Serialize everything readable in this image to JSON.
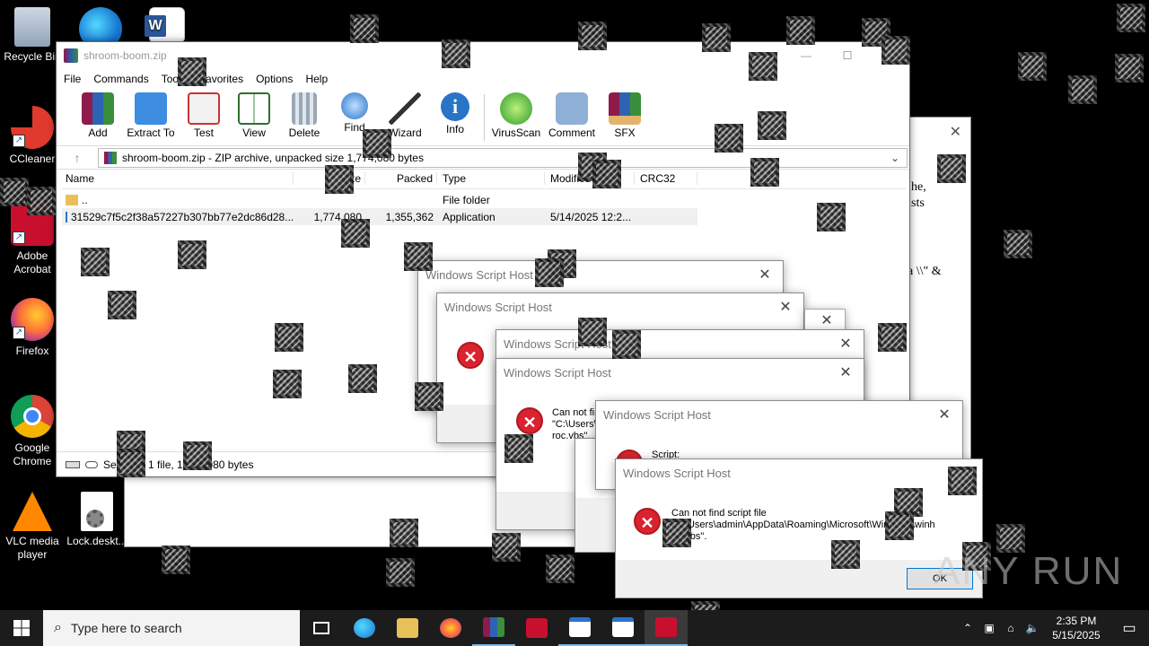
{
  "desktop": {
    "icons": [
      {
        "label": "Recycle Bin",
        "icon": "recycle-bin-icon"
      },
      {
        "label": "CCleaner",
        "icon": "ccleaner-icon"
      },
      {
        "label": "Adobe Acrobat",
        "icon": "adobe-acrobat-icon"
      },
      {
        "label": "Firefox",
        "icon": "firefox-icon"
      },
      {
        "label": "Google Chrome",
        "icon": "chrome-icon"
      },
      {
        "label": "VLC media player",
        "icon": "vlc-icon"
      },
      {
        "label": "Lock.deskt...",
        "icon": "settings-file-icon"
      }
    ]
  },
  "winrar": {
    "title": "shroom-boom.zip",
    "menu": [
      "File",
      "Commands",
      "Tools",
      "Favorites",
      "Options",
      "Help"
    ],
    "toolbar": [
      {
        "label": "Add",
        "icon": "add-archive-icon"
      },
      {
        "label": "Extract To",
        "icon": "extract-folder-icon"
      },
      {
        "label": "Test",
        "icon": "test-clipboard-icon"
      },
      {
        "label": "View",
        "icon": "view-book-icon"
      },
      {
        "label": "Delete",
        "icon": "trash-icon"
      },
      {
        "label": "Find",
        "icon": "magnifier-icon"
      },
      {
        "label": "Wizard",
        "icon": "wand-icon"
      },
      {
        "label": "Info",
        "icon": "info-icon"
      },
      {
        "label": "VirusScan",
        "icon": "virus-scan-icon"
      },
      {
        "label": "Comment",
        "icon": "comment-icon"
      },
      {
        "label": "SFX",
        "icon": "sfx-box-icon"
      }
    ],
    "address": "shroom-boom.zip - ZIP archive, unpacked size 1,774,080 bytes",
    "columns": [
      "Name",
      "Size",
      "Packed",
      "Type",
      "Modified",
      "CRC32"
    ],
    "rows": [
      {
        "name": "..",
        "size": "",
        "packed": "",
        "type": "File folder",
        "modified": "",
        "crc": ""
      },
      {
        "name": "31529c7f5c2f38a57227b307bb77e2dc86d28...",
        "size": "1,774,080",
        "packed": "1,355,362",
        "type": "Application",
        "modified": "5/14/2025 12:2...",
        "crc": ""
      }
    ],
    "status": "Selected 1 file, 1,774,080 bytes"
  },
  "background_doc": {
    "text1": "he,",
    "text2": "sts",
    "text3": "a \\\\\" &"
  },
  "dialogs": {
    "title": "Windows Script Host",
    "msg_prefix": "Can not find script file",
    "path_a": "\"C:\\Users\\",
    "path_a_tail": "roc.vbs\".",
    "script_label": "Script:",
    "front_line1": "Can not find script file",
    "front_line2": "\"C:\\Users\\admin\\AppData\\Roaming\\Microsoft\\Windows\\winh",
    "front_line3": "en.vbs\".",
    "ok_label": "OK"
  },
  "watermark": "ANY RUN",
  "taskbar": {
    "search_placeholder": "Type here to search",
    "time": "2:35 PM",
    "date": "5/15/2025"
  }
}
